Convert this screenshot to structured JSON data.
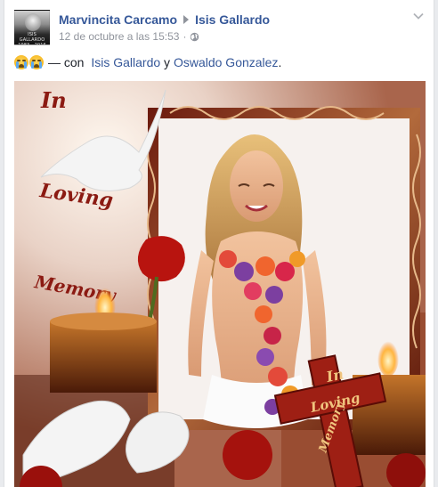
{
  "post": {
    "author": "Marvincita Carcamo",
    "recipient": "Isis Gallardo",
    "timestamp": "12 de octubre a las 15:53",
    "separator": "·",
    "privacy_icon": "globe-icon",
    "menu_icon": "chevron-down-icon",
    "avatar_text": "ISIS GALLARDO 1983 - 2016",
    "emojis": [
      "crying-face",
      "crying-face"
    ],
    "text_prefix": "— con ",
    "tagged_1": "Isis Gallardo",
    "connector": " y ",
    "tagged_2": "Oswaldo Gonzalez",
    "text_suffix": "."
  },
  "photo": {
    "word_in_1": "In",
    "word_loving_1": "Loving",
    "word_memory_1": "Memory",
    "word_in_2": "In",
    "word_loving_2": "Loving",
    "word_memory_2": "Memory"
  },
  "colors": {
    "link": "#365899",
    "meta": "#90949c",
    "memorial_text": "#8b1a12"
  }
}
